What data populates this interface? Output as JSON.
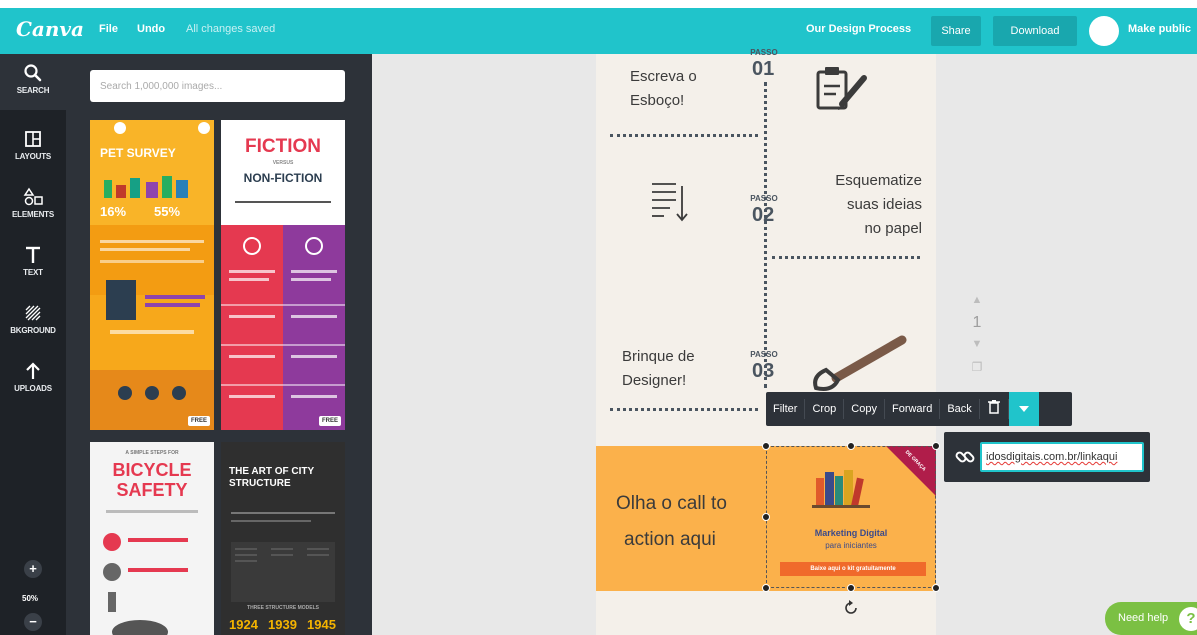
{
  "header": {
    "logo": "Canva",
    "file_label": "File",
    "undo_label": "Undo",
    "status": "All changes saved",
    "document_title": "Our Design Process",
    "share_label": "Share",
    "download_label": "Download",
    "make_public_label": "Make public"
  },
  "toolbar": {
    "items": [
      {
        "label": "SEARCH",
        "icon": "search-icon"
      },
      {
        "label": "LAYOUTS",
        "icon": "layouts-icon"
      },
      {
        "label": "ELEMENTS",
        "icon": "shapes-icon"
      },
      {
        "label": "TEXT",
        "icon": "text-icon"
      },
      {
        "label": "BKGROUND",
        "icon": "background-icon"
      },
      {
        "label": "UPLOADS",
        "icon": "upload-icon"
      }
    ],
    "zoom_level": "50%"
  },
  "panel": {
    "search_placeholder": "Search 1,000,000 images...",
    "templates": {
      "pet_survey": {
        "title": "PET SURVEY",
        "stat_a": "16%",
        "stat_b": "55%",
        "badge": "FREE"
      },
      "fiction": {
        "title": "FICTION",
        "versus": "VERSUS",
        "subtitle": "NON-FICTION",
        "badge": "FREE"
      },
      "bicycle": {
        "kicker": "A SIMPLE STEPS FOR",
        "title_line1": "BICYCLE",
        "title_line2": "SAFETY"
      },
      "city": {
        "title_line1": "THE ART OF CITY",
        "title_line2": "STRUCTURE",
        "models_label": "THREE STRUCTURE MODELS",
        "years": [
          "1924",
          "1939",
          "1945"
        ]
      }
    }
  },
  "design": {
    "step1": {
      "text_line1": "Escreva o",
      "text_line2": "Esboço!",
      "label": "PASSO",
      "number": "01"
    },
    "step2": {
      "text_line1": "Esquematize",
      "text_line2": "suas ideias",
      "text_line3": "no papel",
      "label": "PASSO",
      "number": "02"
    },
    "step3": {
      "text_line1": "Brinque de",
      "text_line2": "Designer!",
      "label": "PASSO",
      "number": "03"
    },
    "cta": {
      "text_line1": "Olha o call to",
      "text_line2": "action aqui",
      "ribbon": "DE GRAÇA",
      "book_title": "Marketing Digital",
      "book_subtitle": "para iniciantes",
      "button_label": "Baixe aqui o kit gratuitamente"
    }
  },
  "actionbar": {
    "filter": "Filter",
    "crop": "Crop",
    "copy": "Copy",
    "forward": "Forward",
    "back": "Back"
  },
  "link": {
    "value": "idosdigitais.com.br/linkaqui"
  },
  "page_controls": {
    "page_number": "1"
  },
  "help": {
    "label": "Need help",
    "q": "?"
  }
}
